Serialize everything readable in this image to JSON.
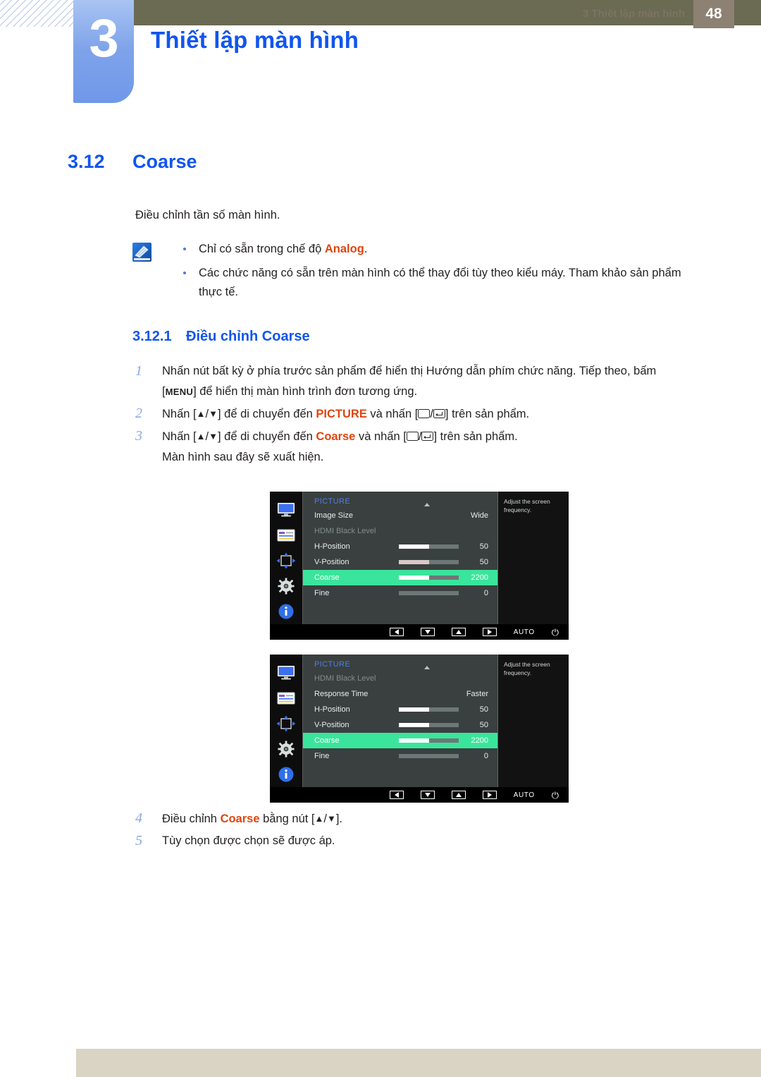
{
  "header": {
    "chapter_number": "3",
    "chapter_title": "Thiết lập màn hình"
  },
  "section": {
    "number": "3.12",
    "title": "Coarse",
    "intro": "Điều chỉnh tần số màn hình."
  },
  "note": {
    "icon": "note-pen-icon",
    "items": [
      {
        "pre": "Chỉ có sẵn trong chế độ ",
        "accent": "Analog",
        "post": "."
      },
      {
        "pre": "Các chức năng có sẵn trên màn hình có thể thay đổi tùy theo kiểu máy. Tham khảo sản phẩm thực tế.",
        "accent": "",
        "post": ""
      }
    ]
  },
  "subsection": {
    "number": "3.12.1",
    "title": "Điều chỉnh Coarse"
  },
  "steps": [
    {
      "num": "1",
      "line1_a": "Nhấn nút bất kỳ ở phía trước sản phẩm để hiển thị Hướng dẫn phím chức năng. Tiếp theo, bấm",
      "keycap": "MENU",
      "line2_b": "] để hiển thị màn hình trình đơn tương ứng.",
      "line2_open": "["
    },
    {
      "num": "2",
      "a": "Nhấn [",
      "b": "] để di chuyển đến ",
      "accent": "PICTURE",
      "c": " và nhấn [",
      "d": "] trên sản phẩm."
    },
    {
      "num": "3",
      "a": "Nhấn [",
      "b": "] để di chuyển đến ",
      "accent": "Coarse",
      "c": " và nhấn [",
      "d": "] trên sản phẩm.",
      "sub": "Màn hình sau đây sẽ xuất hiện."
    },
    {
      "num": "4",
      "a": "Điều chỉnh ",
      "accent": "Coarse",
      "b": " bằng nút [",
      "c": "]."
    },
    {
      "num": "5",
      "a": "Tùy chọn được chọn sẽ được áp."
    }
  ],
  "osd": {
    "title": "PICTURE",
    "description": "Adjust the screen frequency.",
    "sidebar_icons": [
      "monitor-icon",
      "color-panel-icon",
      "position-arrows-icon",
      "gear-icon",
      "info-icon"
    ],
    "footer": {
      "left_label": "left-arrow-button",
      "down_label": "down-arrow-button",
      "up_label": "up-arrow-button",
      "right_label": "right-arrow-button",
      "auto": "AUTO",
      "power": "⏻"
    },
    "highlight_color": "#3ae59b",
    "screen_one": {
      "rows": [
        {
          "label": "Image Size",
          "type": "option",
          "value": "Wide",
          "state": "normal"
        },
        {
          "label": "HDMI Black Level",
          "type": "plain",
          "value": "",
          "state": "dim"
        },
        {
          "label": "H-Position",
          "type": "slider",
          "value": "50",
          "fill": 50,
          "state": "normal"
        },
        {
          "label": "V-Position",
          "type": "slider",
          "value": "50",
          "fill": 50,
          "state": "normal"
        },
        {
          "label": "Coarse",
          "type": "slider",
          "value": "2200",
          "fill": 50,
          "state": "highlight"
        },
        {
          "label": "Fine",
          "type": "slider",
          "value": "0",
          "fill": 0,
          "state": "normal"
        }
      ]
    },
    "screen_two": {
      "rows": [
        {
          "label": "HDMI Black Level",
          "type": "plain",
          "value": "",
          "state": "dim"
        },
        {
          "label": "Response Time",
          "type": "option",
          "value": "Faster",
          "state": "normal"
        },
        {
          "label": "H-Position",
          "type": "slider",
          "value": "50",
          "fill": 50,
          "state": "normal"
        },
        {
          "label": "V-Position",
          "type": "slider",
          "value": "50",
          "fill": 50,
          "state": "normal"
        },
        {
          "label": "Coarse",
          "type": "slider",
          "value": "2200",
          "fill": 50,
          "state": "highlight"
        },
        {
          "label": "Fine",
          "type": "slider",
          "value": "0",
          "fill": 0,
          "state": "normal"
        }
      ]
    }
  },
  "footer": {
    "text": "3 Thiết lập màn hình",
    "page": "48"
  }
}
